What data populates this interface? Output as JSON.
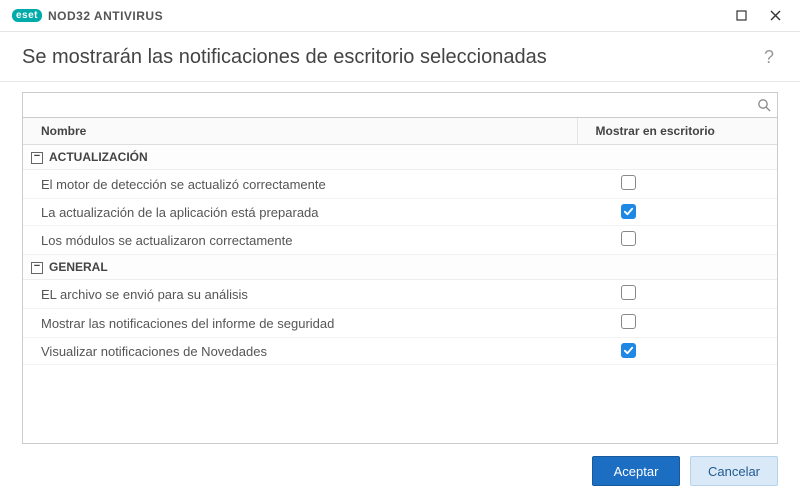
{
  "titlebar": {
    "brand_badge": "eset",
    "product_name": "NOD32 ANTIVIRUS"
  },
  "header": {
    "title": "Se mostrarán las notificaciones de escritorio seleccionadas",
    "help_symbol": "?"
  },
  "search": {
    "value": "",
    "placeholder": ""
  },
  "columns": {
    "name": "Nombre",
    "show": "Mostrar en escritorio"
  },
  "groups": [
    {
      "title": "ACTUALIZACIÓN",
      "items": [
        {
          "label": "El motor de detección se actualizó correctamente",
          "checked": false
        },
        {
          "label": "La actualización de la aplicación está preparada",
          "checked": true
        },
        {
          "label": "Los módulos se actualizaron correctamente",
          "checked": false
        }
      ]
    },
    {
      "title": "GENERAL",
      "items": [
        {
          "label": "EL archivo se envió para su análisis",
          "checked": false
        },
        {
          "label": "Mostrar las notificaciones del informe de seguridad",
          "checked": false
        },
        {
          "label": "Visualizar notificaciones de Novedades",
          "checked": true
        }
      ]
    }
  ],
  "footer": {
    "accept": "Aceptar",
    "cancel": "Cancelar"
  }
}
